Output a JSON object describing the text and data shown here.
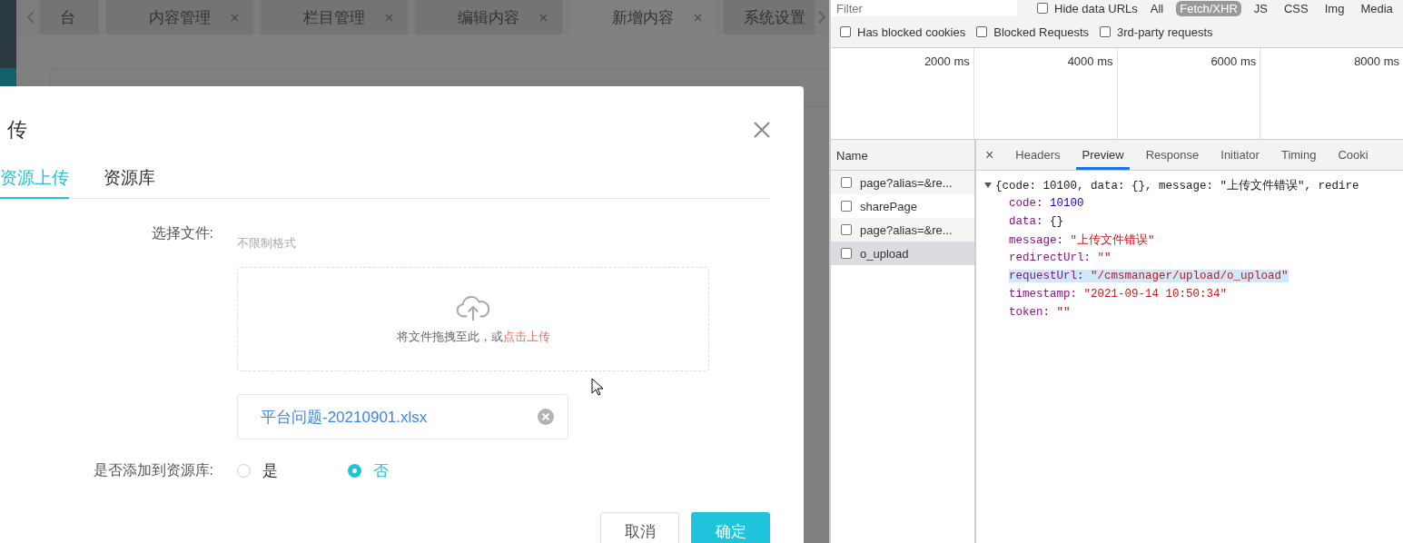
{
  "app_tabs": [
    {
      "label": "台",
      "closable": false,
      "selected": false
    },
    {
      "label": "内容管理",
      "closable": true,
      "selected": false
    },
    {
      "label": "栏目管理",
      "closable": true,
      "selected": false
    },
    {
      "label": "编辑内容",
      "closable": true,
      "selected": false
    },
    {
      "label": "新增内容",
      "closable": true,
      "selected": true
    },
    {
      "label": "系统设置",
      "closable": false,
      "selected": false
    }
  ],
  "dialog": {
    "title": "传",
    "tabs": [
      {
        "label": "资源上传",
        "selected": true
      },
      {
        "label": "资源库",
        "selected": false
      }
    ],
    "file_label": "选择文件:",
    "file_hint": "不限制格式",
    "dropzone": {
      "text": "将文件拖拽至此，或",
      "link": "点击上传"
    },
    "file": {
      "name": "平台问题-20210901.xlsx"
    },
    "library_label": "是否添加到资源库:",
    "library_options": [
      {
        "label": "是",
        "selected": false
      },
      {
        "label": "否",
        "selected": true
      }
    ],
    "buttons": [
      {
        "label": "取消",
        "kind": "secondary"
      },
      {
        "label": "确定",
        "kind": "primary"
      }
    ]
  },
  "devtools": {
    "filter": {
      "placeholder": "Filter"
    },
    "hide_data_urls": {
      "label": "Hide data URLs",
      "checked": false
    },
    "types": [
      {
        "label": "All",
        "selected": false
      },
      {
        "label": "Fetch/XHR",
        "selected": true
      },
      {
        "label": "JS",
        "selected": false
      },
      {
        "label": "CSS",
        "selected": false
      },
      {
        "label": "Img",
        "selected": false
      },
      {
        "label": "Media",
        "selected": false
      }
    ],
    "options": [
      {
        "label": "Has blocked cookies",
        "checked": false
      },
      {
        "label": "Blocked Requests",
        "checked": false
      },
      {
        "label": "3rd-party requests",
        "checked": false
      }
    ],
    "timeline": [
      "2000 ms",
      "4000 ms",
      "6000 ms",
      "8000 ms"
    ],
    "name_header": "Name",
    "requests": [
      {
        "name": "page?alias=&re...",
        "selected": false
      },
      {
        "name": "sharePage",
        "selected": false
      },
      {
        "name": "page?alias=&re...",
        "selected": false
      },
      {
        "name": "o_upload",
        "selected": true
      }
    ],
    "close": "×",
    "detail_tabs": [
      {
        "label": "Headers",
        "selected": false
      },
      {
        "label": "Preview",
        "selected": true
      },
      {
        "label": "Response",
        "selected": false
      },
      {
        "label": "Initiator",
        "selected": false
      },
      {
        "label": "Timing",
        "selected": false
      },
      {
        "label": "Cooki",
        "selected": false
      }
    ],
    "preview": [
      {
        "kind": "summary",
        "text": "{code: 10100, data: {}, message: \"上传文件错误\", redire",
        "expanded": true
      },
      {
        "kind": "number",
        "key": "code:",
        "value": "10100",
        "selected": false
      },
      {
        "kind": "object",
        "key": "data:",
        "value": "{}",
        "selected": false
      },
      {
        "kind": "string",
        "key": "message:",
        "value": "\"上传文件错误\"",
        "selected": false
      },
      {
        "kind": "string",
        "key": "redirectUrl:",
        "value": "\"\"",
        "selected": false
      },
      {
        "kind": "string",
        "key": "requestUrl:",
        "value": "\"/cmsmanager/upload/o_upload\"",
        "selected": true
      },
      {
        "kind": "string",
        "key": "timestamp:",
        "value": "\"2021-09-14 10:50:34\"",
        "selected": false
      },
      {
        "kind": "string",
        "key": "token:",
        "value": "\"\"",
        "selected": false
      }
    ]
  }
}
